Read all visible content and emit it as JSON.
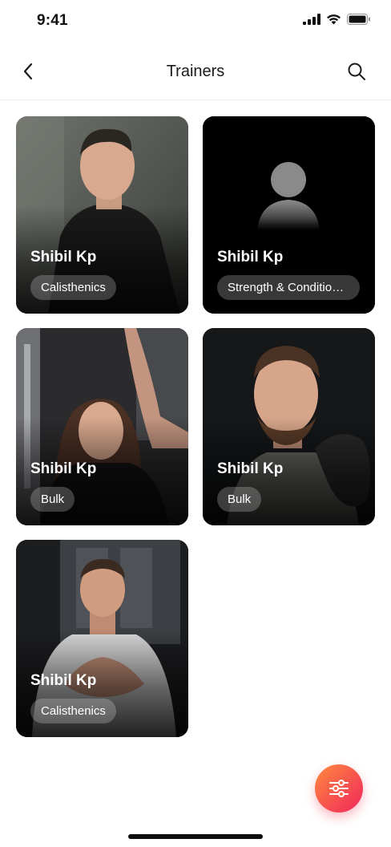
{
  "status": {
    "time": "9:41"
  },
  "header": {
    "title": "Trainers"
  },
  "trainers": [
    {
      "name": "Shibil Kp",
      "tag": "Calisthenics"
    },
    {
      "name": "Shibil Kp",
      "tag": "Strength & Conditioni..."
    },
    {
      "name": "Shibil Kp",
      "tag": "Bulk"
    },
    {
      "name": "Shibil Kp",
      "tag": "Bulk"
    },
    {
      "name": "Shibil Kp",
      "tag": "Calisthenics"
    }
  ],
  "icons": {
    "back": "chevron-left-icon",
    "search": "search-icon",
    "filter": "sliders-icon",
    "placeholder": "person-placeholder-icon"
  },
  "colors": {
    "fab_start": "#ff8a3d",
    "fab_end": "#f0265d",
    "card_bg": "#000000"
  }
}
